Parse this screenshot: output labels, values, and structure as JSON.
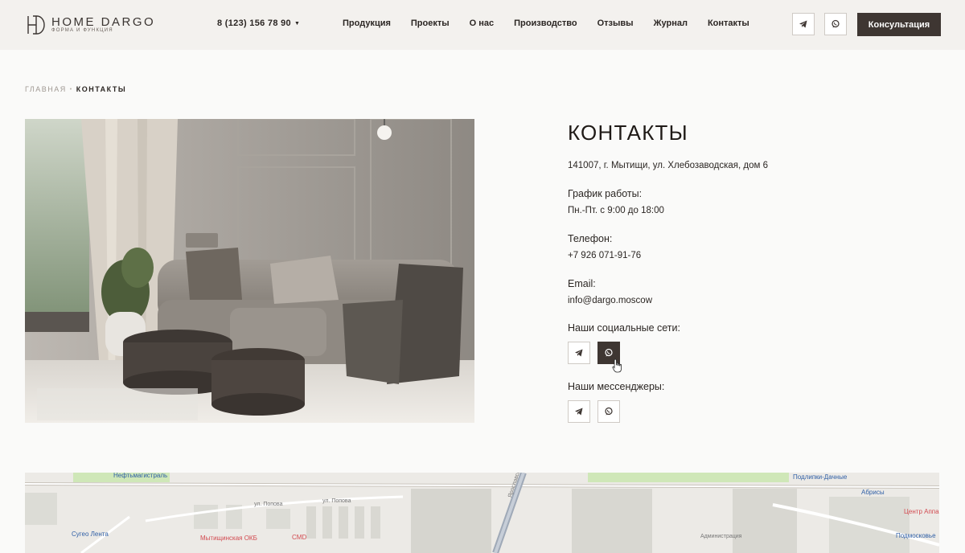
{
  "header": {
    "logo": {
      "name": "HOME DARGO",
      "tagline": "форма и функция"
    },
    "phone": "8 (123) 156 78 90",
    "nav": [
      "Продукция",
      "Проекты",
      "О нас",
      "Производство",
      "Отзывы",
      "Журнал",
      "Контакты"
    ],
    "cta_label": "Консультация",
    "icons": [
      "telegram-icon",
      "whatsapp-icon"
    ]
  },
  "breadcrumb": {
    "home": "Главная",
    "current": "Контакты"
  },
  "contacts": {
    "title": "КОНТАКТЫ",
    "address": "141007, г. Мытищи, ул. Хлебозаводская, дом 6",
    "schedule_label": "График работы:",
    "schedule_value": "Пн.-Пт. с 9:00 до 18:00",
    "phone_label": "Телефон:",
    "phone_value": "+7 926 071-91-76",
    "email_label": "Email:",
    "email_value": "info@dargo.moscow",
    "social_label": "Наши социальные сети:",
    "messengers_label": "Наши мессенджеры:"
  },
  "map": {
    "labels": [
      "Нефтьмагистраль",
      "Подлипки-Дачные",
      "Абрисы",
      "Сугео Лента",
      "Мытищинская ОКБ",
      "CMD",
      "Администрация",
      "Подмосковье",
      "Центр Аппаратной Косметологии",
      "ул. Попова",
      "ул. Попова",
      "Ярославское шоссе"
    ]
  },
  "colors": {
    "accent": "#3e3632",
    "header_bg": "#f3f1ee",
    "page_bg": "#fafaf9"
  }
}
